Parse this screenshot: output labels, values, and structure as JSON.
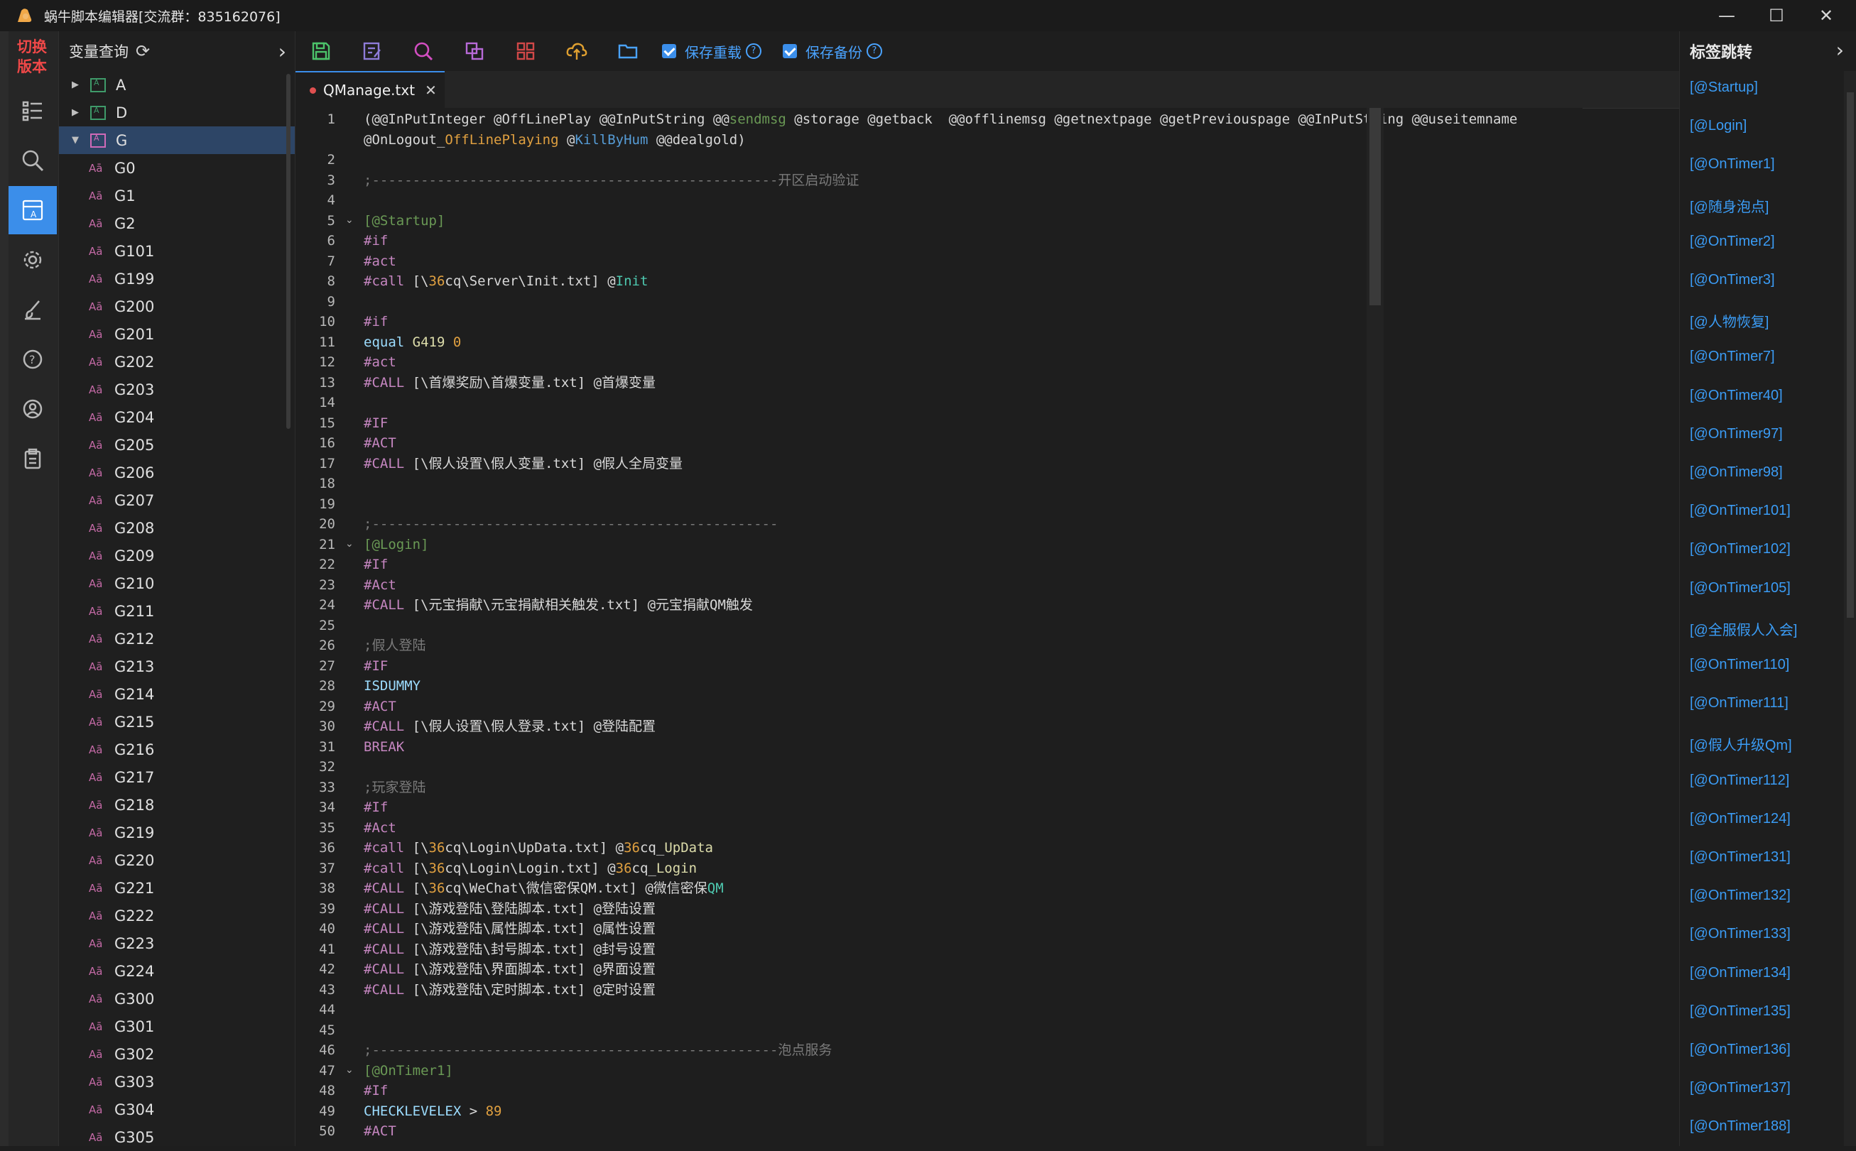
{
  "window": {
    "title": "蜗牛脚本编辑器[交流群：835162076]",
    "minimize": "—",
    "maximize": "☐",
    "close": "✕"
  },
  "rail": {
    "switch_label": "切换\n版本"
  },
  "var_panel": {
    "title": "变量查询",
    "groups": [
      {
        "label": "A",
        "expanded": false
      },
      {
        "label": "D",
        "expanded": false
      },
      {
        "label": "G",
        "expanded": true
      }
    ],
    "items": [
      "G0",
      "G1",
      "G2",
      "G101",
      "G199",
      "G200",
      "G201",
      "G202",
      "G203",
      "G204",
      "G205",
      "G206",
      "G207",
      "G208",
      "G209",
      "G210",
      "G211",
      "G212",
      "G213",
      "G214",
      "G215",
      "G216",
      "G217",
      "G218",
      "G219",
      "G220",
      "G221",
      "G222",
      "G223",
      "G224",
      "G300",
      "G301",
      "G302",
      "G303",
      "G304",
      "G305"
    ]
  },
  "toolbar": {
    "reload_label": "保存重载",
    "backup_label": "保存备份"
  },
  "tab": {
    "name": "QManage.txt",
    "close": "✕"
  },
  "colors": {
    "accent": "#3b8eea",
    "link": "#3b9cf5",
    "switch_red": "#f04848"
  },
  "editor": {
    "lines": [
      {
        "n": "1",
        "segs": [
          [
            "(@@InPutInteger @OffLinePlay @@InPutString @@",
            ""
          ],
          [
            "sendmsg",
            "c-green"
          ],
          [
            " @storage @getback  @@offlinemsg @getnextpage @getPreviouspage @@InPutString @@useitemname",
            ""
          ]
        ]
      },
      {
        "n": "",
        "segs": [
          [
            "@OnLogout_",
            ""
          ],
          [
            "OffLinePlaying",
            "c-orange"
          ],
          [
            " @",
            ""
          ],
          [
            "KillByHum",
            "c-blue"
          ],
          [
            " @@dealgold)",
            ""
          ]
        ]
      },
      {
        "n": "2",
        "segs": []
      },
      {
        "n": "3",
        "segs": [
          [
            ";--------------------------------------------------开区启动验证",
            "c-com"
          ]
        ]
      },
      {
        "n": "4",
        "segs": []
      },
      {
        "n": "5",
        "fold": true,
        "segs": [
          [
            "[@Startup]",
            "c-green"
          ]
        ]
      },
      {
        "n": "6",
        "segs": [
          [
            "#if",
            "c-kw"
          ]
        ]
      },
      {
        "n": "7",
        "segs": [
          [
            "#act",
            "c-kw"
          ]
        ]
      },
      {
        "n": "8",
        "segs": [
          [
            "#call",
            "c-kw"
          ],
          [
            " [\\",
            ""
          ],
          [
            "36",
            "c-orange"
          ],
          [
            "cq\\Server\\Init.txt] @",
            ""
          ],
          [
            "Init",
            "c-func"
          ]
        ]
      },
      {
        "n": "9",
        "segs": []
      },
      {
        "n": "10",
        "segs": [
          [
            "#if",
            "c-kw"
          ]
        ]
      },
      {
        "n": "11",
        "segs": [
          [
            "equal",
            "c-dim"
          ],
          [
            " ",
            ""
          ],
          [
            "G419",
            "c-yellow"
          ],
          [
            " ",
            ""
          ],
          [
            "0",
            "c-orange"
          ]
        ]
      },
      {
        "n": "12",
        "segs": [
          [
            "#act",
            "c-kw"
          ]
        ]
      },
      {
        "n": "13",
        "segs": [
          [
            "#CALL",
            "c-kw"
          ],
          [
            " [\\首爆奖励\\首爆变量.txt] @首爆变量",
            ""
          ]
        ]
      },
      {
        "n": "14",
        "segs": []
      },
      {
        "n": "15",
        "segs": [
          [
            "#IF",
            "c-kw"
          ]
        ]
      },
      {
        "n": "16",
        "segs": [
          [
            "#ACT",
            "c-kw"
          ]
        ]
      },
      {
        "n": "17",
        "segs": [
          [
            "#CALL",
            "c-kw"
          ],
          [
            " [\\假人设置\\假人变量.txt] @假人全局变量",
            ""
          ]
        ]
      },
      {
        "n": "18",
        "segs": []
      },
      {
        "n": "19",
        "segs": []
      },
      {
        "n": "20",
        "segs": [
          [
            ";--------------------------------------------------",
            "c-com"
          ]
        ]
      },
      {
        "n": "21",
        "fold": true,
        "segs": [
          [
            "[@Login]",
            "c-green"
          ]
        ]
      },
      {
        "n": "22",
        "segs": [
          [
            "#If",
            "c-kw"
          ]
        ]
      },
      {
        "n": "23",
        "segs": [
          [
            "#Act",
            "c-kw"
          ]
        ]
      },
      {
        "n": "24",
        "segs": [
          [
            "#CALL",
            "c-kw"
          ],
          [
            " [\\元宝捐献\\元宝捐献相关触发.txt] @元宝捐献QM触发",
            ""
          ]
        ]
      },
      {
        "n": "25",
        "segs": []
      },
      {
        "n": "26",
        "segs": [
          [
            ";假人登陆",
            "c-com"
          ]
        ]
      },
      {
        "n": "27",
        "segs": [
          [
            "#IF",
            "c-kw"
          ]
        ]
      },
      {
        "n": "28",
        "segs": [
          [
            "ISDUMMY",
            "c-dim"
          ]
        ]
      },
      {
        "n": "29",
        "segs": [
          [
            "#ACT",
            "c-kw"
          ]
        ]
      },
      {
        "n": "30",
        "segs": [
          [
            "#CALL",
            "c-kw"
          ],
          [
            " [\\假人设置\\假人登录.txt] @登陆配置",
            ""
          ]
        ]
      },
      {
        "n": "31",
        "segs": [
          [
            "BREAK",
            "c-kw"
          ]
        ]
      },
      {
        "n": "32",
        "segs": []
      },
      {
        "n": "33",
        "segs": [
          [
            ";玩家登陆",
            "c-com"
          ]
        ]
      },
      {
        "n": "34",
        "segs": [
          [
            "#If",
            "c-kw"
          ]
        ]
      },
      {
        "n": "35",
        "segs": [
          [
            "#Act",
            "c-kw"
          ]
        ]
      },
      {
        "n": "36",
        "segs": [
          [
            "#call",
            "c-kw"
          ],
          [
            " [\\",
            ""
          ],
          [
            "36",
            "c-orange"
          ],
          [
            "cq\\Login\\UpData.txt] @",
            ""
          ],
          [
            "36",
            "c-orange"
          ],
          [
            "cq_",
            ""
          ],
          [
            "UpData",
            "c-yellow"
          ]
        ]
      },
      {
        "n": "37",
        "segs": [
          [
            "#call",
            "c-kw"
          ],
          [
            " [\\",
            ""
          ],
          [
            "36",
            "c-orange"
          ],
          [
            "cq\\Login\\Login.txt] @",
            ""
          ],
          [
            "36",
            "c-orange"
          ],
          [
            "cq_",
            ""
          ],
          [
            "Login",
            "c-yellow"
          ]
        ]
      },
      {
        "n": "38",
        "segs": [
          [
            "#CALL",
            "c-kw"
          ],
          [
            " [\\",
            ""
          ],
          [
            "36",
            "c-orange"
          ],
          [
            "cq\\WeChat\\微信密保QM.txt] @微信密保",
            ""
          ],
          [
            "QM",
            "c-func"
          ]
        ]
      },
      {
        "n": "39",
        "segs": [
          [
            "#CALL",
            "c-kw"
          ],
          [
            " [\\游戏登陆\\登陆脚本.txt] @登陆设置",
            ""
          ]
        ]
      },
      {
        "n": "40",
        "segs": [
          [
            "#CALL",
            "c-kw"
          ],
          [
            " [\\游戏登陆\\属性脚本.txt] @属性设置",
            ""
          ]
        ]
      },
      {
        "n": "41",
        "segs": [
          [
            "#CALL",
            "c-kw"
          ],
          [
            " [\\游戏登陆\\封号脚本.txt] @封号设置",
            ""
          ]
        ]
      },
      {
        "n": "42",
        "segs": [
          [
            "#CALL",
            "c-kw"
          ],
          [
            " [\\游戏登陆\\界面脚本.txt] @界面设置",
            ""
          ]
        ]
      },
      {
        "n": "43",
        "segs": [
          [
            "#CALL",
            "c-kw"
          ],
          [
            " [\\游戏登陆\\定时脚本.txt] @定时设置",
            ""
          ]
        ]
      },
      {
        "n": "44",
        "segs": []
      },
      {
        "n": "45",
        "segs": []
      },
      {
        "n": "46",
        "segs": [
          [
            ";--------------------------------------------------泡点服务",
            "c-com"
          ]
        ]
      },
      {
        "n": "47",
        "fold": true,
        "segs": [
          [
            "[@OnTimer1]",
            "c-green"
          ]
        ]
      },
      {
        "n": "48",
        "segs": [
          [
            "#If",
            "c-kw"
          ]
        ]
      },
      {
        "n": "49",
        "segs": [
          [
            "CHECKLEVELEX",
            "c-dim"
          ],
          [
            " > ",
            ""
          ],
          [
            "89",
            "c-orange"
          ]
        ]
      },
      {
        "n": "50",
        "segs": [
          [
            "#ACT",
            "c-kw"
          ]
        ]
      }
    ]
  },
  "right_panel": {
    "title": "标签跳转",
    "tags": [
      "[@Startup]",
      "[@Login]",
      "[@OnTimer1]",
      "[@随身泡点]",
      "[@OnTimer2]",
      "[@OnTimer3]",
      "[@人物恢复]",
      "[@OnTimer7]",
      "[@OnTimer40]",
      "[@OnTimer97]",
      "[@OnTimer98]",
      "[@OnTimer101]",
      "[@OnTimer102]",
      "[@OnTimer105]",
      "[@全服假人入会]",
      "[@OnTimer110]",
      "[@OnTimer111]",
      "[@假人升级Qm]",
      "[@OnTimer112]",
      "[@OnTimer124]",
      "[@OnTimer131]",
      "[@OnTimer132]",
      "[@OnTimer133]",
      "[@OnTimer134]",
      "[@OnTimer135]",
      "[@OnTimer136]",
      "[@OnTimer137]",
      "[@OnTimer188]"
    ]
  }
}
